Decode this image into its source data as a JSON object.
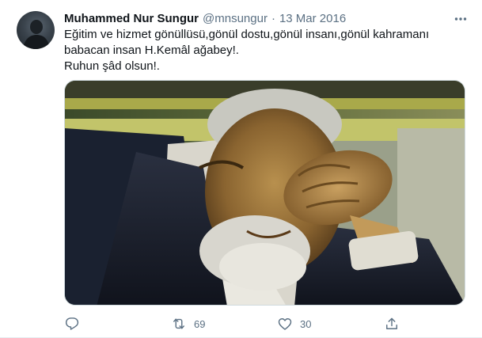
{
  "tweet": {
    "author": {
      "display_name": "Muhammed Nur Sungur",
      "handle": "@mnsungur",
      "separator": "·",
      "date": "13 Mar 2016"
    },
    "more_icon": "more-horizontal-icon",
    "text_lines": [
      "Eğitim ve hizmet gönüllüsü,gönül dostu,gönül insanı,gönül kahramanı",
      "babacan insan H.Kemâl ağabey!.",
      "Ruhun şâd olsun!."
    ],
    "actions": {
      "reply": {
        "icon": "reply-icon"
      },
      "retweet": {
        "icon": "retweet-icon",
        "count": "69"
      },
      "like": {
        "icon": "heart-icon",
        "count": "30"
      },
      "share": {
        "icon": "share-icon"
      }
    },
    "colors": {
      "text": "#0f1419",
      "secondary": "#5b7083",
      "border": "#cfd9de"
    }
  }
}
